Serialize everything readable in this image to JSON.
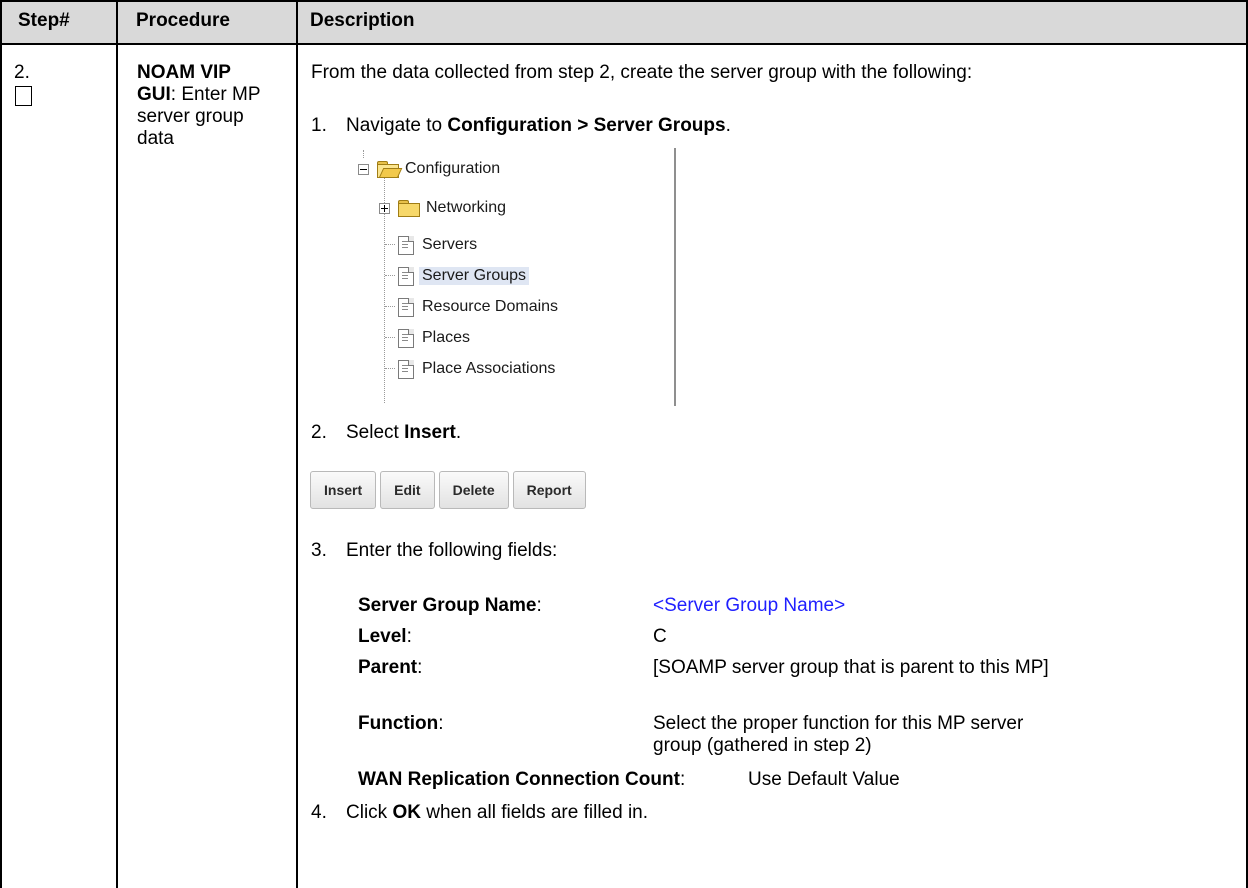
{
  "table": {
    "headers": {
      "step": "Step#",
      "procedure": "Procedure",
      "description": "Description"
    }
  },
  "row": {
    "step_number": "2.",
    "procedure_bold": "NOAM VIP GUI",
    "procedure_rest": ": Enter MP server group data",
    "intro": "From the data collected from step 2, create the server group with the following:",
    "steps": [
      {
        "num": "1.",
        "pre": "Navigate to ",
        "bold": "Configuration > Server Groups",
        "post": "."
      },
      {
        "num": "2.",
        "pre": "Select ",
        "bold": "Insert",
        "post": "."
      },
      {
        "num": "3.",
        "pre": "Enter the following fields:",
        "bold": "",
        "post": ""
      },
      {
        "num": "4.",
        "pre": "Click ",
        "bold": "OK",
        "post": " when all fields are filled in."
      }
    ]
  },
  "tree": {
    "root": {
      "label": "Configuration",
      "icon": "folder-open-icon",
      "toggle": "collapse-icon"
    },
    "children": [
      {
        "label": "Networking",
        "icon": "folder-icon",
        "toggle": "expand-icon"
      },
      {
        "label": "Servers",
        "icon": "document-icon"
      },
      {
        "label": "Server Groups",
        "icon": "document-icon",
        "selected": true
      },
      {
        "label": "Resource Domains",
        "icon": "document-icon"
      },
      {
        "label": "Places",
        "icon": "document-icon"
      },
      {
        "label": "Place Associations",
        "icon": "document-icon"
      }
    ],
    "selected_bg": "#dfe6f3"
  },
  "toolbar": {
    "buttons": [
      "Insert",
      "Edit",
      "Delete",
      "Report"
    ]
  },
  "fields": [
    {
      "label": "Server Group Name",
      "value": "<Server Group Name>",
      "placeholder_color": "#1f1fff"
    },
    {
      "label": "Level",
      "value": "C"
    },
    {
      "label": "Parent",
      "value": "[SOAMP server group that is parent to this MP]"
    },
    {
      "label": "Function",
      "value": "Select the proper function for this MP server group (gathered in step 2)"
    },
    {
      "label": "WAN Replication Connection Count",
      "value": "Use Default Value"
    }
  ],
  "colors": {
    "header_bg": "#d9d9d9",
    "link": "#1f1fff"
  }
}
